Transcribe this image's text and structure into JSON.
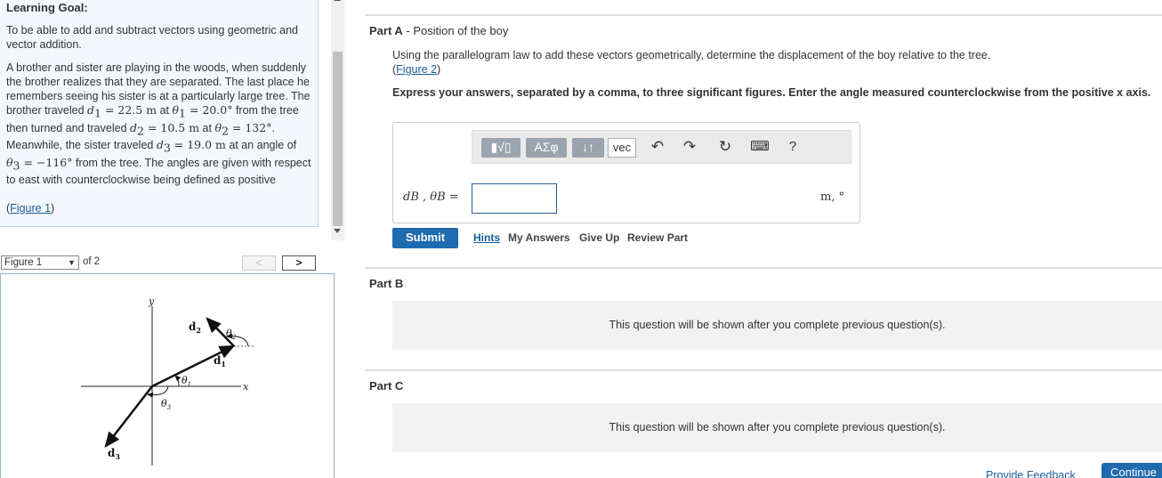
{
  "learning_goal": {
    "title": "Learning Goal:",
    "goal_text": "To be able to add and subtract vectors using geometric and vector addition.",
    "problem": {
      "p1": "A brother and sister are playing in the woods, when suddenly the brother realizes that they are separated. The last place he remembers seeing his sister is at a particularly large tree. The brother traveled ",
      "d1_sym": "d",
      "d1_sub": "1",
      "d1_val": " = 22.5 m",
      "p2": "at ",
      "t1_sym": "θ",
      "t1_sub": "1",
      "t1_val": " = 20.0°",
      "p3": " from the tree then turned and traveled",
      "d2_sym": "d",
      "d2_sub": "2",
      "d2_val": " = 10.5 m",
      "p4": " at ",
      "t2_sym": "θ",
      "t2_sub": "2",
      "t2_val": " = 132°",
      "p5": ". Meanwhile, the sister traveled ",
      "d3_sym": "d",
      "d3_sub": "3",
      "d3_val": " = 19.0 m",
      "p6": " at an angle of ",
      "t3_sym": "θ",
      "t3_sub": "3",
      "t3_val": " = −116°",
      "p7": " from the tree. The angles are given with respect to east with counterclockwise being defined as positive"
    },
    "figure_link": "Figure 1"
  },
  "figure_nav": {
    "selected": "Figure 1",
    "of_text": "of 2",
    "prev": "<",
    "next": ">"
  },
  "figure": {
    "y_label": "y",
    "x_label": "x",
    "d1": "d",
    "d1_sub": "1",
    "d2": "d",
    "d2_sub": "2",
    "d3": "d",
    "d3_sub": "3",
    "theta1": "θ",
    "theta1_sub": "1",
    "theta2": "θ",
    "theta2_sub": "2",
    "theta3": "θ",
    "theta3_sub": "3"
  },
  "part_a": {
    "label": "Part A",
    "dash": " - ",
    "title": "Position of the boy",
    "instruction": "Using the parallelogram law to add these vectors geometrically, determine the displacement of the boy relative to the tree.",
    "figure_link": "Figure 2",
    "express": "Express your answers, separated by a comma, to three significant figures. Enter the angle measured counterclockwise from the positive x axis.",
    "answer_label": "dB , θB =",
    "answer_value": "",
    "units": "m, °",
    "toolbar": {
      "templates": "▮√▯",
      "greek": "ΑΣφ",
      "updown": "↓↑",
      "vec": "vec",
      "undo": "↶",
      "redo": "↷",
      "reset": "↻",
      "keyboard": "⌨",
      "help": "?"
    },
    "submit": "Submit",
    "hints": "Hints",
    "my_answers": "My Answers",
    "give_up": "Give Up",
    "review": "Review Part"
  },
  "part_b": {
    "label": "Part B",
    "locked_text": "This question will be shown after you complete previous question(s)."
  },
  "part_c": {
    "label": "Part C",
    "locked_text": "This question will be shown after you complete previous question(s)."
  },
  "footer": {
    "feedback": "Provide Feedback",
    "continue": "Continue"
  }
}
